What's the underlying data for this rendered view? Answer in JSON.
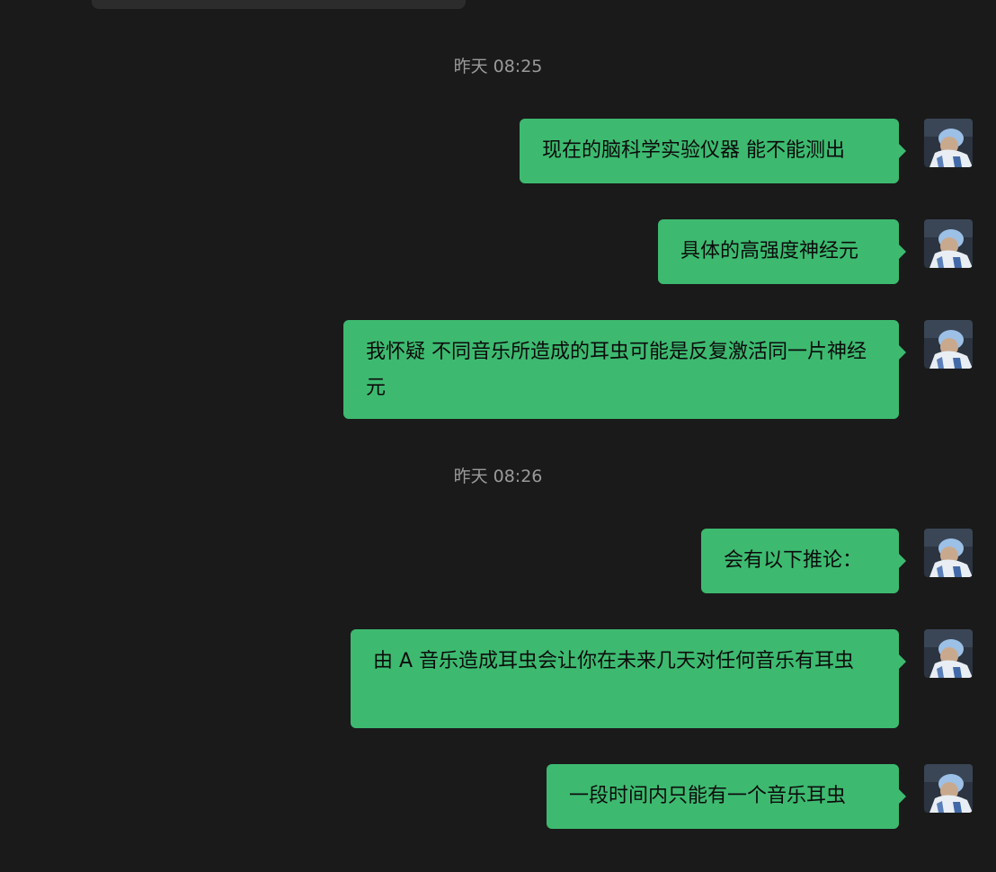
{
  "chat": {
    "timestamps": [
      "昨天 08:25",
      "昨天 08:26"
    ],
    "messages": [
      {
        "text": "现在的脑科学实验仪器 能不能测出",
        "sender": "me"
      },
      {
        "text": "具体的高强度神经元",
        "sender": "me"
      },
      {
        "text": "我怀疑 不同音乐所造成的耳虫可能是反复激活同一片神经元",
        "sender": "me"
      },
      {
        "text": "会有以下推论：",
        "sender": "me"
      },
      {
        "text": "由 A 音乐造成耳虫会让你在未来几天对任何音乐有耳虫",
        "sender": "me"
      },
      {
        "text": "一段时间内只能有一个音乐耳虫",
        "sender": "me"
      }
    ]
  },
  "colors": {
    "background": "#1a1a1a",
    "bubble": "#3dba70",
    "timestamp": "#9a9a9a"
  },
  "icons": {
    "avatar": "user-avatar-icon"
  }
}
